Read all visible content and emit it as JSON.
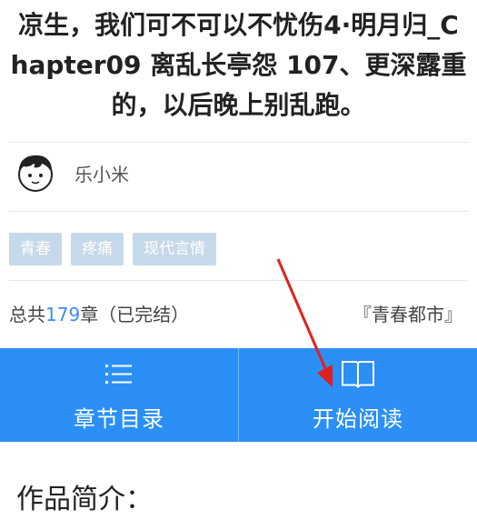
{
  "book": {
    "title_line1": "凉生，我们可不可以不忧伤4·明月归_C",
    "title_line2": "hapter09 离乱长亭怨 107、更深露重",
    "title_line3": "的，以后晚上别乱跑。"
  },
  "author": {
    "name": "乐小米",
    "avatar_icon": "boy-avatar-icon"
  },
  "tags": [
    "青春",
    "疼痛",
    "现代言情"
  ],
  "meta": {
    "prefix": "总共",
    "chapter_count": "179",
    "suffix": "章（已完结）",
    "category": "『青春都市』"
  },
  "actions": {
    "toc_label": "章节目录",
    "toc_icon": "list-icon",
    "read_label": "开始阅读",
    "read_icon": "open-book-icon"
  },
  "intro": {
    "heading": "作品简介："
  },
  "colors": {
    "accent": "#2b8ff5",
    "tag_bg": "#c6d9ea",
    "count": "#3b8df0",
    "annotation_arrow": "#e02020"
  }
}
